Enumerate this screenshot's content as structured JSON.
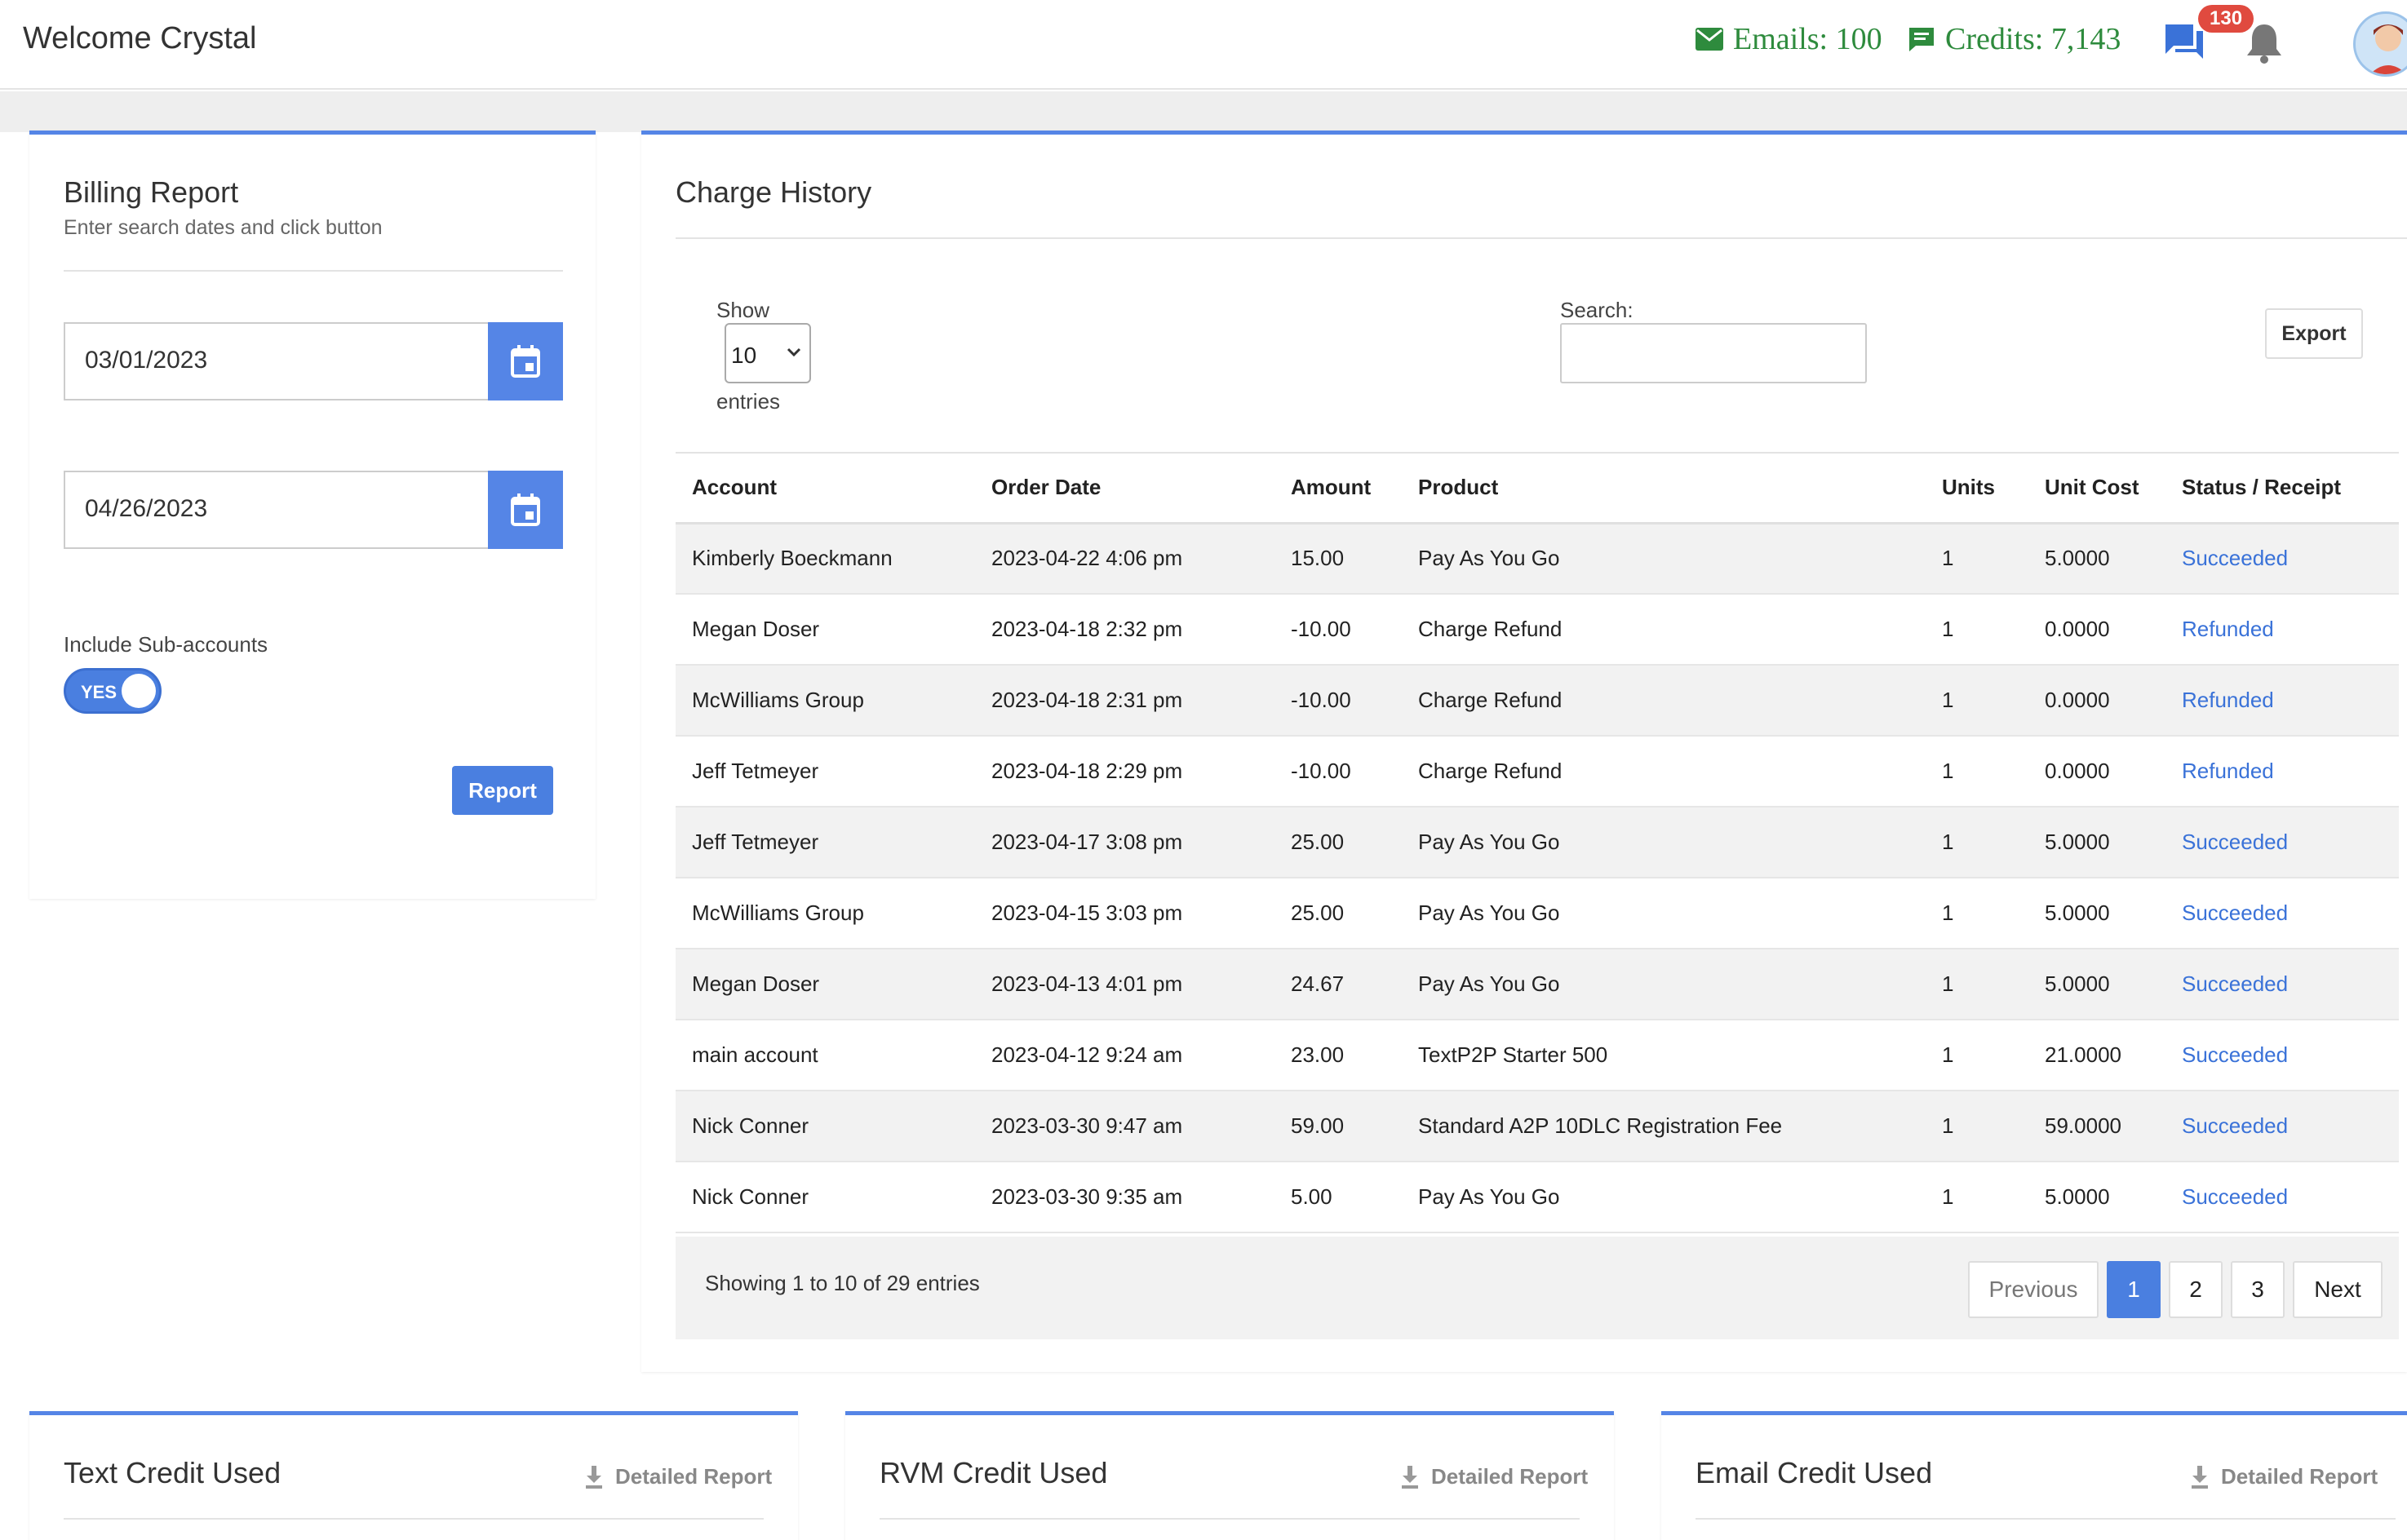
{
  "header": {
    "welcome": "Welcome Crystal",
    "emails": "Emails: 100",
    "credits": "Credits: 7,143",
    "notification_count": "130",
    "accent_color": "#2e8b3d"
  },
  "billing": {
    "title": "Billing Report",
    "subtitle": "Enter search dates and click button",
    "start_date": "03/01/2023",
    "end_date": "04/26/2023",
    "sub_accounts_label": "Include Sub-accounts",
    "toggle_text": "YES",
    "report_button": "Report"
  },
  "charge_history": {
    "title": "Charge History",
    "show_label": "Show",
    "show_value": "10",
    "entries_label": "entries",
    "search_label": "Search:",
    "export_button": "Export",
    "columns": [
      "Account",
      "Order Date",
      "Amount",
      "Product",
      "Units",
      "Unit Cost",
      "Status / Receipt"
    ],
    "rows": [
      [
        "Kimberly Boeckmann",
        "2023-04-22 4:06 pm",
        "15.00",
        "Pay As You Go",
        "1",
        "5.0000",
        "Succeeded"
      ],
      [
        "Megan Doser",
        "2023-04-18 2:32 pm",
        "-10.00",
        "Charge Refund",
        "1",
        "0.0000",
        "Refunded"
      ],
      [
        "McWilliams Group",
        "2023-04-18 2:31 pm",
        "-10.00",
        "Charge Refund",
        "1",
        "0.0000",
        "Refunded"
      ],
      [
        "Jeff Tetmeyer",
        "2023-04-18 2:29 pm",
        "-10.00",
        "Charge Refund",
        "1",
        "0.0000",
        "Refunded"
      ],
      [
        "Jeff Tetmeyer",
        "2023-04-17 3:08 pm",
        "25.00",
        "Pay As You Go",
        "1",
        "5.0000",
        "Succeeded"
      ],
      [
        "McWilliams Group",
        "2023-04-15 3:03 pm",
        "25.00",
        "Pay As You Go",
        "1",
        "5.0000",
        "Succeeded"
      ],
      [
        "Megan Doser",
        "2023-04-13 4:01 pm",
        "24.67",
        "Pay As You Go",
        "1",
        "5.0000",
        "Succeeded"
      ],
      [
        "main account",
        "2023-04-12 9:24 am",
        "23.00",
        "TextP2P Starter 500",
        "1",
        "21.0000",
        "Succeeded"
      ],
      [
        "Nick Conner",
        "2023-03-30 9:47 am",
        "59.00",
        "Standard A2P 10DLC Registration Fee",
        "1",
        "59.0000",
        "Succeeded"
      ],
      [
        "Nick Conner",
        "2023-03-30 9:35 am",
        "5.00",
        "Pay As You Go",
        "1",
        "5.0000",
        "Succeeded"
      ]
    ],
    "showing_text": "Showing 1 to 10 of 29 entries",
    "pagination": {
      "previous": "Previous",
      "pages": [
        "1",
        "2",
        "3"
      ],
      "next": "Next",
      "active_page": "1"
    }
  },
  "bottom_cards": [
    {
      "title": "Text Credit Used",
      "link": "Detailed Report"
    },
    {
      "title": "RVM Credit Used",
      "link": "Detailed Report"
    },
    {
      "title": "Email Credit Used",
      "link": "Detailed Report"
    }
  ]
}
